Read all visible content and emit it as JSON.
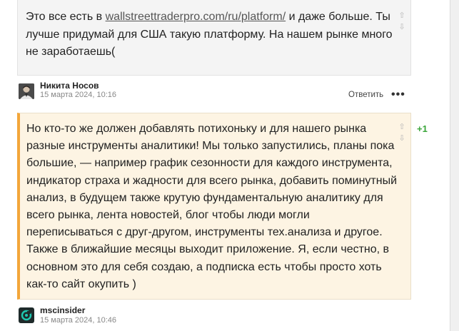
{
  "comments": [
    {
      "text_before": "Это все есть в ",
      "link": "wallstreettraderpro.com/ru/platform/",
      "text_after": " и даже больше. Ты лучше придумай для США такую платформу. На нашем рынке много не заработаешь(",
      "author": "Никита Носов",
      "date": "15 марта 2024, 10:16",
      "reply_label": "Ответить",
      "more_label": "•••"
    },
    {
      "text": "Но кто-то же должен добавлять потихоньку и для нашего рынка разные инструменты аналитики! Мы только запустились, планы пока большие, — например график сезонности для каждого инструмента, индикатор страха и жадности для всего рынка, добавить поминутный анализ, в будущем также крутую фундаментальную аналитику для всего рынка, лента новостей, блог чтобы люди могли переписываться с друг-другом, инструменты тех.анализа и другое. Также в ближайшие месяцы выходит приложение. Я, если честно, в основном это для себя создаю, а подписка есть чтобы просто хоть как-то сайт окупить )",
      "score": "+1",
      "author": "mscinsider",
      "date": "15 марта 2024, 10:46"
    }
  ],
  "icons": {
    "vote_up": "⇧",
    "vote_down": "⇩"
  },
  "colors": {
    "accent_orange": "#f3a63a",
    "highlight_bg": "#fdf4e3",
    "score_green": "#3aa53a"
  }
}
